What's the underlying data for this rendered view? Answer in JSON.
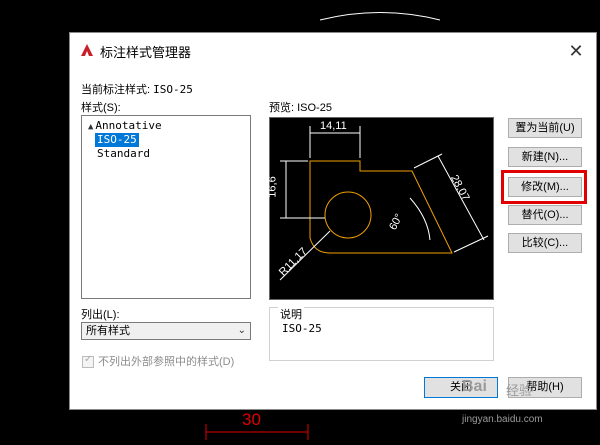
{
  "dialog": {
    "title": "标注样式管理器",
    "close_glyph": "✕"
  },
  "current_style": {
    "label": "当前标注样式:",
    "value": "ISO-25"
  },
  "styles": {
    "label": "样式(S):",
    "items": [
      {
        "name": "Annotative",
        "icon": "annotative-icon",
        "selected": false
      },
      {
        "name": "ISO-25",
        "icon": "",
        "selected": true
      },
      {
        "name": "Standard",
        "icon": "",
        "selected": false
      }
    ]
  },
  "preview": {
    "label": "预览: ISO-25",
    "dims": {
      "top_width": "14,11",
      "left_height": "16,6",
      "diagonal": "28,07",
      "angle": "60°",
      "radius": "R11,17"
    }
  },
  "description": {
    "label": "说明",
    "value": "ISO-25"
  },
  "list_filter": {
    "label": "列出(L):",
    "selected": "所有样式"
  },
  "xref_checkbox": {
    "label": "不列出外部参照中的样式(D)",
    "checked": true,
    "disabled": true
  },
  "buttons": {
    "set_current": "置为当前(U)",
    "new": "新建(N)...",
    "modify": "修改(M)...",
    "override": "替代(O)...",
    "compare": "比较(C)...",
    "close": "关闭",
    "help": "帮助(H)"
  },
  "background": {
    "dimension_text": "30"
  },
  "watermark": {
    "line1": "Bai",
    "line2": "经验",
    "url": "jingyan.baidu.com"
  },
  "colors": {
    "geometry": "#f0a000",
    "dimension": "#ffffff",
    "highlight": "#e00000",
    "selection": "#0078d7",
    "background_dimension": "#e00000"
  }
}
